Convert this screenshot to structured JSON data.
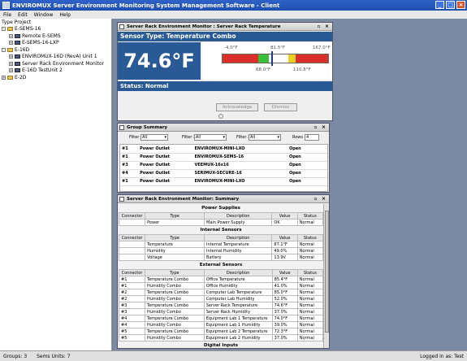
{
  "app": {
    "title": "ENVIROMUX Server Environment Monitoring System Management Software - Client",
    "menu": [
      "File",
      "Edit",
      "Window",
      "Help"
    ]
  },
  "tree": {
    "header": "Type Project",
    "nodes": [
      {
        "label": "E-SEMS-16",
        "level": 0,
        "exp": "-"
      },
      {
        "label": "Remote E-SEMS",
        "level": 1,
        "exp": "+"
      },
      {
        "label": "E-SEMS-16-LXP",
        "level": 1,
        "exp": "+"
      },
      {
        "label": "E-16D",
        "level": 0,
        "exp": "-"
      },
      {
        "label": "ENVIROMUX-16D (RevA) Unit 1",
        "level": 1,
        "exp": "+"
      },
      {
        "label": "Server Rack Environment Monitor",
        "level": 1,
        "exp": "+"
      },
      {
        "label": "E-16D TestUnit 2",
        "level": 1,
        "exp": "+"
      },
      {
        "label": "E-2D",
        "level": 0,
        "exp": "+"
      }
    ]
  },
  "sensor_window": {
    "title": "Server Rack Environment Monitor : Server Rack Temperature",
    "sensor_type": "Sensor Type: Temperature Combo",
    "value": "74.6°F",
    "gauge": {
      "min_label": "-4.0°F",
      "max_label": "167.0°F",
      "low_thresh": "68.0°F",
      "high_thresh": "110.8°F",
      "current_marker": "81.5°F",
      "value_fraction": 0.46
    },
    "status": "Status: Normal",
    "acknowledge": "Acknowledge",
    "dismiss": "Dismiss"
  },
  "group_window": {
    "title": "Group Summary",
    "filter1_label": "Filter 1",
    "filter2_label": "Filter 2",
    "filter3_label": "Filter 3",
    "filter_value": "All",
    "rows_label": "Rows",
    "rows_value": "4",
    "rows": [
      [
        "#1",
        "Power Outlet",
        "ENVIROMUX-MINI-LXO",
        "Open"
      ],
      [
        "#1",
        "Power Outlet",
        "ENVIROMUX-SEMS-16",
        "Open"
      ],
      [
        "#3",
        "Power Outlet",
        "VEEMUX-16x16",
        "Open"
      ],
      [
        "#4",
        "Power Outlet",
        "SERIMUX-SECURE-16",
        "Open"
      ],
      [
        "#1",
        "Power Outlet",
        "ENVIROMUX-MINI-LXO",
        "Open"
      ]
    ]
  },
  "summary_window": {
    "title": "Server Rack Environment Monitor: Summary",
    "columns": [
      "Connector",
      "Type",
      "Description",
      "Value",
      "Status"
    ],
    "power_title": "Power Supplies",
    "power_rows": [
      [
        "",
        "Power",
        "Main Power Supply",
        "OK",
        "Normal"
      ]
    ],
    "internal_title": "Internal Sensors",
    "internal_rows": [
      [
        "",
        "Temperature",
        "Internal Temperature",
        "87.1°F",
        "Normal"
      ],
      [
        "",
        "Humidity",
        "Internal Humidity",
        "49.0%",
        "Normal"
      ],
      [
        "",
        "Voltage",
        "Battery",
        "13.9V",
        "Normal"
      ]
    ],
    "external_title": "External Sensors",
    "external_rows": [
      [
        "#1",
        "Temperature Combo",
        "Office Temperature",
        "85.4°F",
        "Normal"
      ],
      [
        "#1",
        "Humidity Combo",
        "Office Humidity",
        "41.0%",
        "Normal"
      ],
      [
        "#2",
        "Temperature Combo",
        "Computer Lab Temperature",
        "85.0°F",
        "Normal"
      ],
      [
        "#2",
        "Humidity Combo",
        "Computer Lab Humidity",
        "52.0%",
        "Normal"
      ],
      [
        "#3",
        "Temperature Combo",
        "Server Rack Temperature",
        "74.6°F",
        "Normal"
      ],
      [
        "#3",
        "Humidity Combo",
        "Server Rack Humidity",
        "37.0%",
        "Normal"
      ],
      [
        "#4",
        "Temperature Combo",
        "Equipment Lab 1 Temperature",
        "74.0°F",
        "Normal"
      ],
      [
        "#4",
        "Humidity Combo",
        "Equipment Lab 1 Humidity",
        "39.0%",
        "Normal"
      ],
      [
        "#5",
        "Temperature Combo",
        "Equipment Lab 2 Temperature",
        "72.3°F",
        "Normal"
      ],
      [
        "#5",
        "Humidity Combo",
        "Equipment Lab 2 Humidity",
        "37.0%",
        "Normal"
      ]
    ],
    "digital_title": "Digital Inputs"
  },
  "status_bar": {
    "groups": "Groups: 3",
    "sems_units": "Sems Units: 7",
    "logged_in": "Logged in as: Test"
  },
  "colors": {
    "accent_blue": "#2a5a96",
    "gauge_red": "#d9302a",
    "gauge_green": "#3cc03c",
    "gauge_yellow": "#e8d020"
  }
}
